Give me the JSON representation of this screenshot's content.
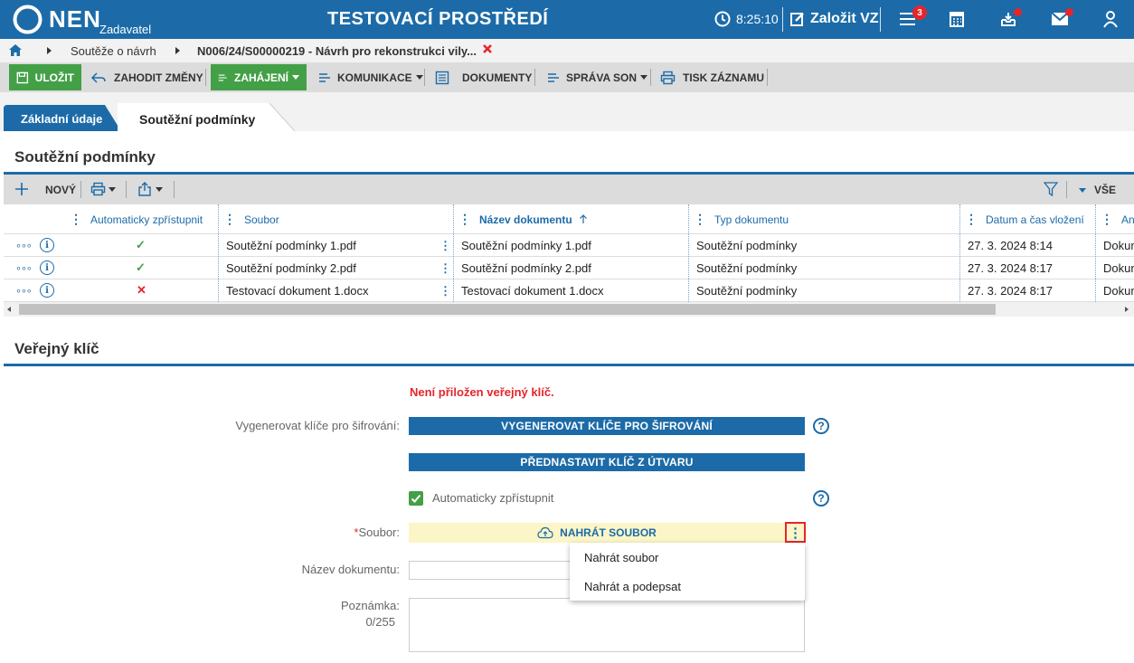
{
  "header": {
    "logo_text": "NEN",
    "logo_sub": "Zadavatel",
    "title": "TESTOVACÍ PROSTŘEDÍ",
    "clock": "8:25:10",
    "create_label": "Založit VZ",
    "menu_badge": "3",
    "icons": [
      "clock-icon",
      "edit-icon",
      "menu-icon",
      "calculator-icon",
      "inbox-icon",
      "mail-icon",
      "user-icon"
    ]
  },
  "breadcrumb": {
    "item1": "Soutěže o návrh",
    "item2": "N006/24/S00000219 - Návrh pro rekonstrukci vily..."
  },
  "toolbar": {
    "save": "ULOŽIT",
    "discard": "ZAHODIT ZMĚNY",
    "start": "ZAHÁJENÍ",
    "communication": "KOMUNIKACE",
    "documents": "DOKUMENTY",
    "son": "SPRÁVA SON",
    "print": "TISK ZÁZNAMU"
  },
  "tabs": {
    "tab1": "Základní údaje",
    "tab2": "Soutěžní podmínky"
  },
  "section1": {
    "title": "Soutěžní podmínky",
    "new_label": "NOVÝ",
    "filter_all": "VŠE"
  },
  "table": {
    "headers": [
      "Automaticky zpřístupnit",
      "Soubor",
      "Název dokumentu",
      "Typ dokumentu",
      "Datum a čas vložení",
      "Anti"
    ],
    "rows": [
      {
        "auto": "✓",
        "file": "Soutěžní podmínky 1.pdf",
        "name": "Soutěžní podmínky 1.pdf",
        "type": "Soutěžní podmínky",
        "date": "27. 3. 2024 8:14",
        "extra": "Dokum"
      },
      {
        "auto": "✓",
        "file": "Soutěžní podmínky 2.pdf",
        "name": "Soutěžní podmínky 2.pdf",
        "type": "Soutěžní podmínky",
        "date": "27. 3. 2024 8:17",
        "extra": "Dokum"
      },
      {
        "auto": "✕",
        "file": "Testovací dokument 1.docx",
        "name": "Testovací dokument 1.docx",
        "type": "Soutěžní podmínky",
        "date": "27. 3. 2024 8:17",
        "extra": "Dokum"
      }
    ],
    "row_dots": "∘∘∘",
    "info_glyph": "i"
  },
  "section2": {
    "title": "Veřejný klíč",
    "warning": "Není přiložen veřejný klíč.",
    "gen_label": "Vygenerovat klíče pro šifrování:",
    "gen_button": "VYGENEROVAT KLÍČE PRO ŠIFROVÁNÍ",
    "preset_button": "PŘEDNASTAVIT KLÍČ Z ÚTVARU",
    "auto_label": "Automaticky zpřístupnit",
    "file_label": "Soubor:",
    "required_mark": "*",
    "upload_button": "NAHRÁT SOUBOR",
    "docname_label": "Název dokumentu:",
    "note_label": "Poznámka:",
    "note_counter": "0/255",
    "help_glyph": "?"
  },
  "dropdown": {
    "item1": "Nahrát soubor",
    "item2": "Nahrát a podepsat"
  },
  "colors": {
    "brand_blue": "#1c6ba8",
    "green": "#43a047",
    "warning_red": "#e4262c",
    "upload_bg": "#fbf5c8"
  }
}
